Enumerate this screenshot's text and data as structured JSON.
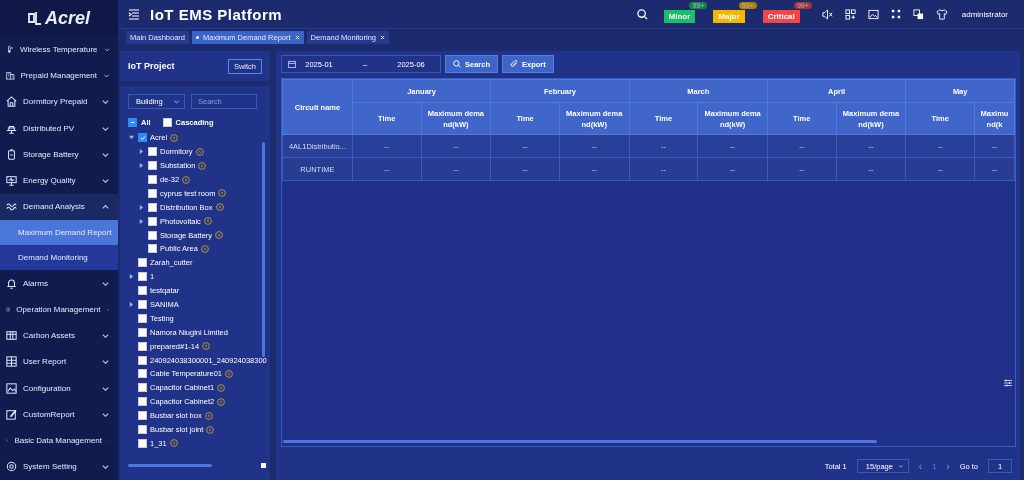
{
  "app": {
    "logo": "Acrel",
    "title": "IoT EMS Platform",
    "user": "administrator"
  },
  "alarms": [
    {
      "label": "Minor",
      "count": "99+",
      "color": "#19be6b"
    },
    {
      "label": "Major",
      "count": "99+",
      "color": "#f7b500"
    },
    {
      "label": "Critical",
      "count": "99+",
      "color": "#f04646"
    }
  ],
  "sidebar": {
    "items": [
      {
        "label": "Wireless Temperature",
        "expanded": false
      },
      {
        "label": "Prepaid Management",
        "expanded": false
      },
      {
        "label": "Dormitory Prepaid",
        "expanded": false
      },
      {
        "label": "Distributed PV",
        "expanded": false
      },
      {
        "label": "Storage Battery",
        "expanded": false
      },
      {
        "label": "Energy Quality",
        "expanded": false
      },
      {
        "label": "Demand Analysis",
        "expanded": true,
        "children": [
          {
            "label": "Maximum Demand Report",
            "selected": true
          },
          {
            "label": "Demand Monitoring",
            "selected": false
          }
        ]
      },
      {
        "label": "Alarms",
        "expanded": false
      },
      {
        "label": "Operation Management",
        "expanded": false
      },
      {
        "label": "Carbon Assets",
        "expanded": false
      },
      {
        "label": "User Report",
        "expanded": false
      },
      {
        "label": "Configuration",
        "expanded": false
      },
      {
        "label": "CustomReport",
        "expanded": false
      },
      {
        "label": "Basic Data Management",
        "expanded": false
      },
      {
        "label": "System Setting",
        "expanded": false
      }
    ]
  },
  "tabs": [
    {
      "label": "Main Dashboard",
      "selected": false,
      "closable": false
    },
    {
      "label": "Maximum Demand Report",
      "selected": true,
      "closable": true
    },
    {
      "label": "Demand Monitoring",
      "selected": false,
      "closable": true
    }
  ],
  "project_panel": {
    "title": "IoT Project",
    "switch_button": "Switch",
    "filter": "Building",
    "search": {
      "placeholder": "Search"
    },
    "all": {
      "label": "All",
      "indeterminate": true
    },
    "cascading": {
      "label": "Cascading",
      "checked": false
    },
    "tree": [
      {
        "label": "Acrel",
        "checked": true,
        "bolt": true,
        "expandable": true,
        "expanded": true,
        "children": [
          {
            "label": "Dormitory",
            "checked": false,
            "bolt": true,
            "expandable": true,
            "expanded": false
          },
          {
            "label": "Substation",
            "checked": false,
            "bolt": true,
            "expandable": true,
            "expanded": false
          },
          {
            "label": "de-32",
            "checked": false,
            "bolt": true,
            "expandable": false
          },
          {
            "label": "cyprus test room",
            "checked": false,
            "bolt": true,
            "expandable": false
          },
          {
            "label": "Distribution Box",
            "checked": false,
            "bolt": true,
            "expandable": true,
            "expanded": false
          },
          {
            "label": "Photovoltaic",
            "checked": false,
            "bolt": true,
            "expandable": true,
            "expanded": false
          },
          {
            "label": "Storage Battery",
            "checked": false,
            "bolt": true,
            "expandable": false
          },
          {
            "label": "Public Area",
            "checked": false,
            "bolt": true,
            "expandable": false
          }
        ]
      },
      {
        "label": "Zarah_cutter",
        "checked": false,
        "bolt": false,
        "expandable": false
      },
      {
        "label": "1",
        "checked": false,
        "bolt": false,
        "expandable": true,
        "expanded": false
      },
      {
        "label": "testqatar",
        "checked": false,
        "bolt": false,
        "expandable": false
      },
      {
        "label": "SANIMA",
        "checked": false,
        "bolt": false,
        "expandable": true,
        "expanded": false
      },
      {
        "label": "Testing",
        "checked": false,
        "bolt": false,
        "expandable": false
      },
      {
        "label": "Namora Niugini Limited",
        "checked": false,
        "bolt": false,
        "expandable": false
      },
      {
        "label": "prepared#1-14",
        "checked": false,
        "bolt": true,
        "expandable": false
      },
      {
        "label": "240924038300001_240924038300",
        "checked": false,
        "bolt": false,
        "expandable": false
      },
      {
        "label": "Cable Temperature01",
        "checked": false,
        "bolt": true,
        "expandable": false
      },
      {
        "label": "Capacitor Cabinet1",
        "checked": false,
        "bolt": true,
        "expandable": false
      },
      {
        "label": "Capacitor Cabinet2",
        "checked": false,
        "bolt": true,
        "expandable": false
      },
      {
        "label": "Busbar slot box",
        "checked": false,
        "bolt": true,
        "expandable": false
      },
      {
        "label": "Busbar slot joint",
        "checked": false,
        "bolt": true,
        "expandable": false
      },
      {
        "label": "1_31",
        "checked": false,
        "bolt": true,
        "expandable": false
      }
    ]
  },
  "toolbar": {
    "date_from": "2025-01",
    "separator": "–",
    "date_to": "2025-06",
    "search_button": "Search",
    "export_button": "Export"
  },
  "table": {
    "first_column": "Circuit name",
    "months": [
      {
        "label": "January",
        "columns": [
          "Time",
          "Maximum dema nd(kW)"
        ]
      },
      {
        "label": "February",
        "columns": [
          "Time",
          "Maximum dema nd(kW)"
        ]
      },
      {
        "label": "March",
        "columns": [
          "Time",
          "Maximum dema nd(kW)"
        ]
      },
      {
        "label": "April",
        "columns": [
          "Time",
          "Maximum dema nd(kW)"
        ]
      },
      {
        "label": "May",
        "columns": [
          "Time",
          "Maximu nd(k"
        ]
      }
    ],
    "rows": [
      {
        "name": "4AL1Distributio...",
        "cells": [
          "--",
          "--",
          "--",
          "--",
          "--",
          "--",
          "--",
          "--",
          "--",
          "--"
        ]
      },
      {
        "name": "RUNTIME",
        "cells": [
          "--",
          "--",
          "--",
          "--",
          "--",
          "--",
          "--",
          "--",
          "--",
          "--"
        ]
      }
    ]
  },
  "pagination": {
    "total": "Total 1",
    "page_size": "15/page",
    "prev": "‹",
    "current": "1",
    "next": "›",
    "goto_label": "Go to",
    "goto_value": "1"
  }
}
